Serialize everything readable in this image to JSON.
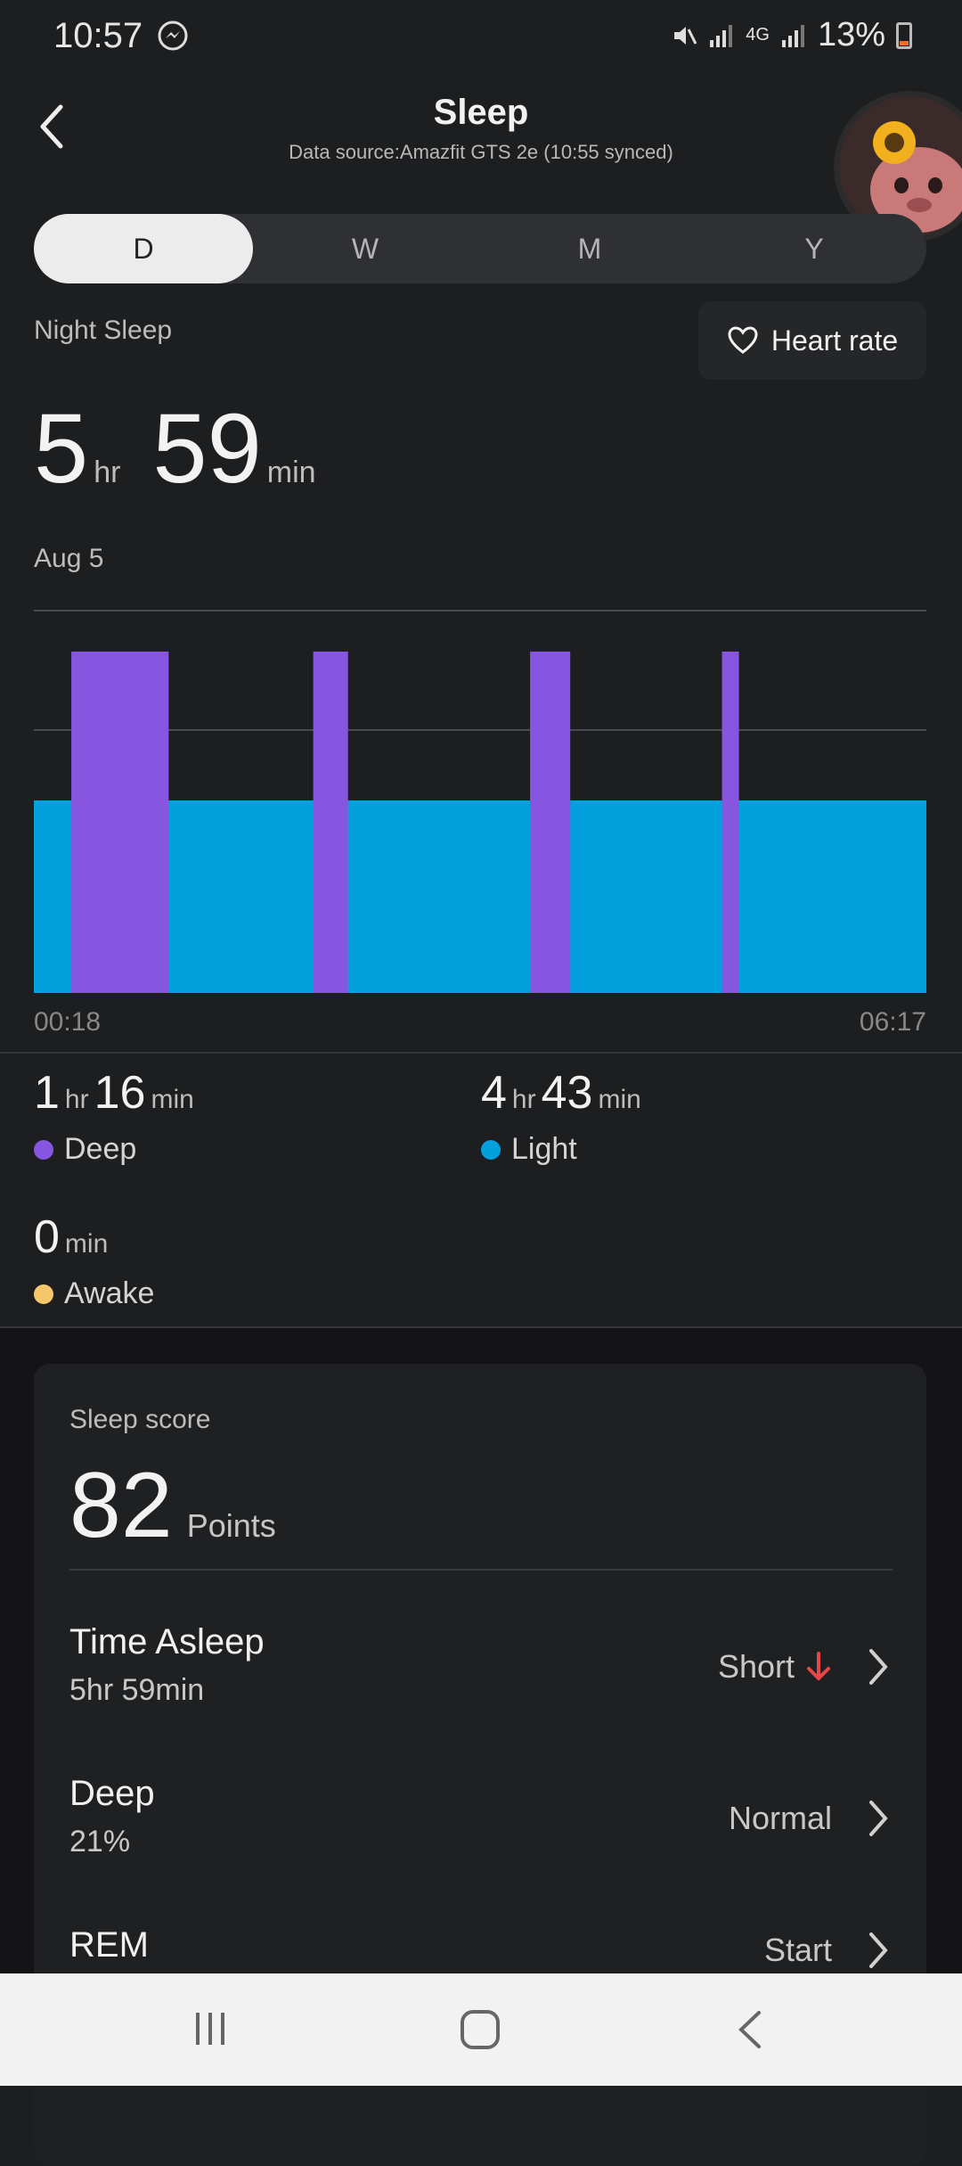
{
  "status_bar": {
    "time": "10:57",
    "battery": "13%",
    "network": "4G"
  },
  "header": {
    "back_icon": "chevron-left-icon",
    "title": "Sleep",
    "data_source": "Data source:Amazfit GTS 2e (10:55 synced)"
  },
  "tabs": [
    {
      "label": "D",
      "active": true
    },
    {
      "label": "W"
    },
    {
      "label": "M"
    },
    {
      "label": "Y"
    }
  ],
  "summary": {
    "label": "Night Sleep",
    "heart_rate_label": "Heart rate",
    "hours": "5",
    "hours_unit": "hr",
    "minutes": "59",
    "minutes_unit": "min",
    "date": "Aug 5",
    "start_time": "00:18",
    "end_time": "06:17"
  },
  "chart_data": {
    "type": "area",
    "x_start": "00:18",
    "x_end": "06:17",
    "series": [
      {
        "name": "Light",
        "color": "#02a0dd",
        "level": "light"
      },
      {
        "name": "Deep",
        "color": "#8756e0",
        "level": "deep",
        "segments_fraction": [
          [
            0.042,
            0.151
          ],
          [
            0.313,
            0.352
          ],
          [
            0.556,
            0.601
          ],
          [
            0.771,
            0.79
          ]
        ]
      }
    ],
    "grid": true
  },
  "stats": [
    {
      "h": "1",
      "h_unit": "hr",
      "m": "16",
      "m_unit": "min",
      "label": "Deep",
      "color": "#8756e0"
    },
    {
      "h": "4",
      "h_unit": "hr",
      "m": "43",
      "m_unit": "min",
      "label": "Light",
      "color": "#02a0dd"
    },
    {
      "m": "0",
      "m_unit": "min",
      "label": "Awake",
      "color": "#f5c76a"
    }
  ],
  "score": {
    "label": "Sleep score",
    "value": "82",
    "unit": "Points",
    "rows": [
      {
        "title": "Time Asleep",
        "sub": "5hr 59min",
        "status": "Short",
        "indicator": "arrow-down-icon",
        "indicator_color": "#e84646"
      },
      {
        "title": "Deep",
        "sub": "21%",
        "status": "Normal"
      },
      {
        "title": "REM",
        "sub": "",
        "status": "Start"
      }
    ]
  }
}
